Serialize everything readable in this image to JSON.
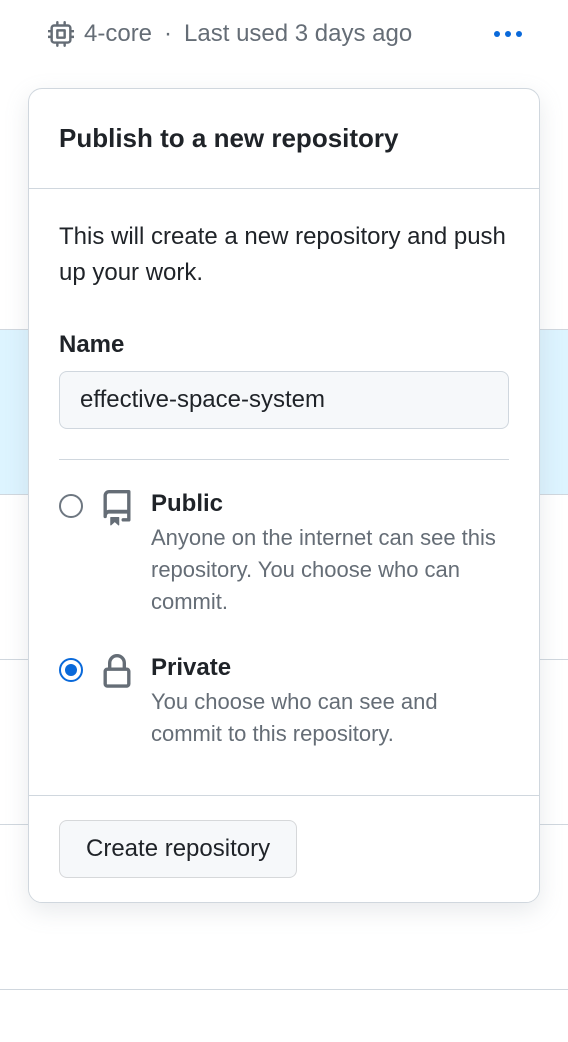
{
  "header": {
    "cpu_spec": "4-core",
    "last_used": "Last used 3 days ago"
  },
  "dialog": {
    "title": "Publish to a new repository",
    "description": "This will create a new repository and push up your work.",
    "name_label": "Name",
    "name_value": "effective-space-system",
    "visibility": {
      "public": {
        "title": "Public",
        "description": "Anyone on the internet can see this repository. You choose who can commit."
      },
      "private": {
        "title": "Private",
        "description": "You choose who can see and commit to this repository."
      },
      "selected": "private"
    },
    "submit_label": "Create repository"
  }
}
